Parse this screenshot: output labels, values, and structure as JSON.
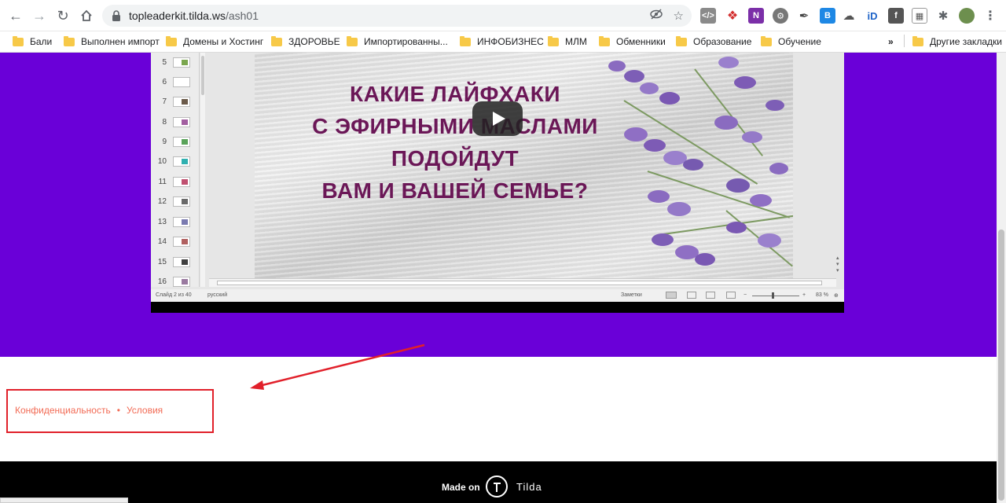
{
  "browser": {
    "url_host": "topleaderkit.tilda.ws",
    "url_path": "/ash01"
  },
  "bookmarks": [
    {
      "label": "Бали"
    },
    {
      "label": "Выполнен импорт"
    },
    {
      "label": "Домены и Хостинг"
    },
    {
      "label": "ЗДОРОВЬЕ"
    },
    {
      "label": "Импортированны..."
    },
    {
      "label": "ИНФОБИЗНЕС"
    },
    {
      "label": "МЛМ"
    },
    {
      "label": "Обменники"
    },
    {
      "label": "Образование"
    },
    {
      "label": "Обучение"
    }
  ],
  "bookmarks_more": "»",
  "other_bookmarks": "Другие закладки",
  "slides_panel": {
    "numbers": [
      "5",
      "6",
      "7",
      "8",
      "9",
      "10",
      "11",
      "12",
      "13",
      "14",
      "15",
      "16"
    ]
  },
  "slide": {
    "lines": [
      "КАКИЕ ЛАЙФХАКИ",
      "С ЭФИРНЫМИ МАСЛАМИ",
      "ПОДОЙДУТ",
      "ВАМ И ВАШЕЙ СЕМЬЕ?"
    ]
  },
  "ppt_status": {
    "slide_of": "Слайд 2 из 40",
    "language": "русский",
    "notes": "Заметки",
    "zoom": "83 %"
  },
  "footer": {
    "privacy": "Конфиденциальность",
    "separator": "•",
    "terms": "Условия"
  },
  "tilda": {
    "made_on": "Made on",
    "brand": "Tilda"
  },
  "colors": {
    "accent_purple": "#6a00d8",
    "link": "#f26b55",
    "annotation": "#e1202a"
  }
}
